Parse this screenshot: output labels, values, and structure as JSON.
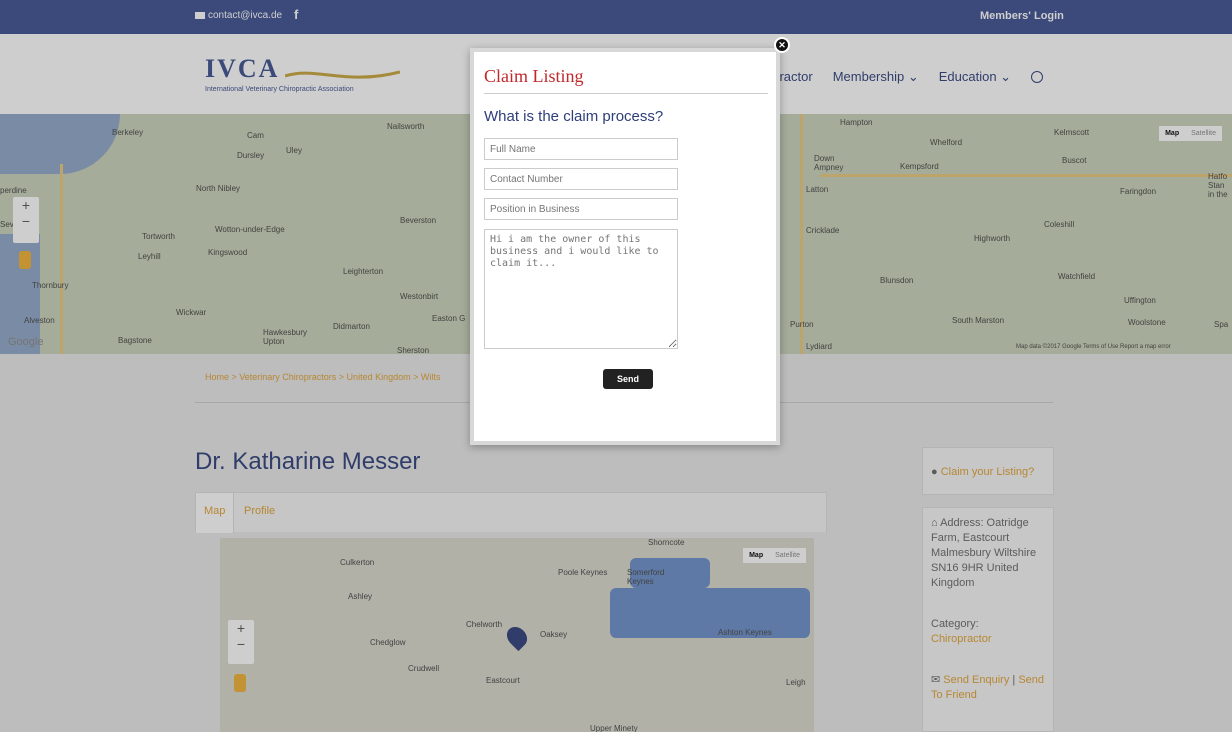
{
  "topbar": {
    "email": "contact@ivca.de",
    "facebook": "f",
    "members_login": "Members' Login"
  },
  "header": {
    "logo_text": "IVCA",
    "logo_tagline": "International Veterinary Chiropractic Association",
    "nav": [
      "opractor",
      "Membership ⌄",
      "Education ⌄"
    ]
  },
  "top_map": {
    "labels": [
      "Berkeley",
      "Cam",
      "Dursley",
      "Uley",
      "Nailsworth",
      "North Nibley",
      "Wotton-under-Edge",
      "Beverston",
      "Tortworth",
      "Leyhill",
      "Kingswood",
      "Thornbury",
      "Leighterton",
      "Westonbirt",
      "Wickwar",
      "Alveston",
      "Hawkesbury Upton",
      "Didmarton",
      "Bagstone",
      "Sherston",
      "Easton G",
      "Hampton",
      "Whelford",
      "Kelmscott",
      "Down Ampney",
      "Kempsford",
      "Buscot",
      "Latton",
      "Faringdon",
      "Cricklade",
      "Highworth",
      "Coleshill",
      "Blunsdon",
      "Watchfield",
      "Purton",
      "Uffington",
      "South Marston",
      "Woolstone",
      "Lydiard",
      "Hatfo Stan in the",
      "Spa",
      "perdine",
      "Severn",
      "Google"
    ],
    "map_btn": "Map",
    "satellite_btn": "Satellite",
    "attribution": "Map data ©2017 Google   Terms of Use   Report a map error"
  },
  "breadcrumb": "Home > Veterinary Chiropractors > United Kingdom > Wilts",
  "page_title": "Dr. Katharine Messer",
  "tabs": [
    "Map",
    "Profile"
  ],
  "small_map": {
    "labels": [
      "Shorncote",
      "Culkerton",
      "Poole Keynes",
      "Somerford Keynes",
      "Ashley",
      "Chelworth",
      "Oaksey",
      "Ashton Keynes",
      "Chedglow",
      "Crudwell",
      "Eastcourt",
      "Leigh",
      "Upper Minety"
    ],
    "map_btn": "Map",
    "satellite_btn": "Satellite"
  },
  "sidebar": {
    "claim_link": "Claim your Listing?",
    "address_label": "Address: Oatridge Farm, Eastcourt Malmesbury Wiltshire SN16 9HR United Kingdom",
    "category_label": "Category:",
    "category_value": "Chiropractor",
    "send_enquiry": "Send Enquiry",
    "send_to_friend": "Send To Friend"
  },
  "modal": {
    "title": "Claim Listing",
    "subtitle": "What is the claim process?",
    "full_name_placeholder": "Full Name",
    "contact_placeholder": "Contact Number",
    "position_placeholder": "Position in Business",
    "message_placeholder": "Hi i am the owner of this business and i would like to claim it...",
    "send_label": "Send"
  }
}
